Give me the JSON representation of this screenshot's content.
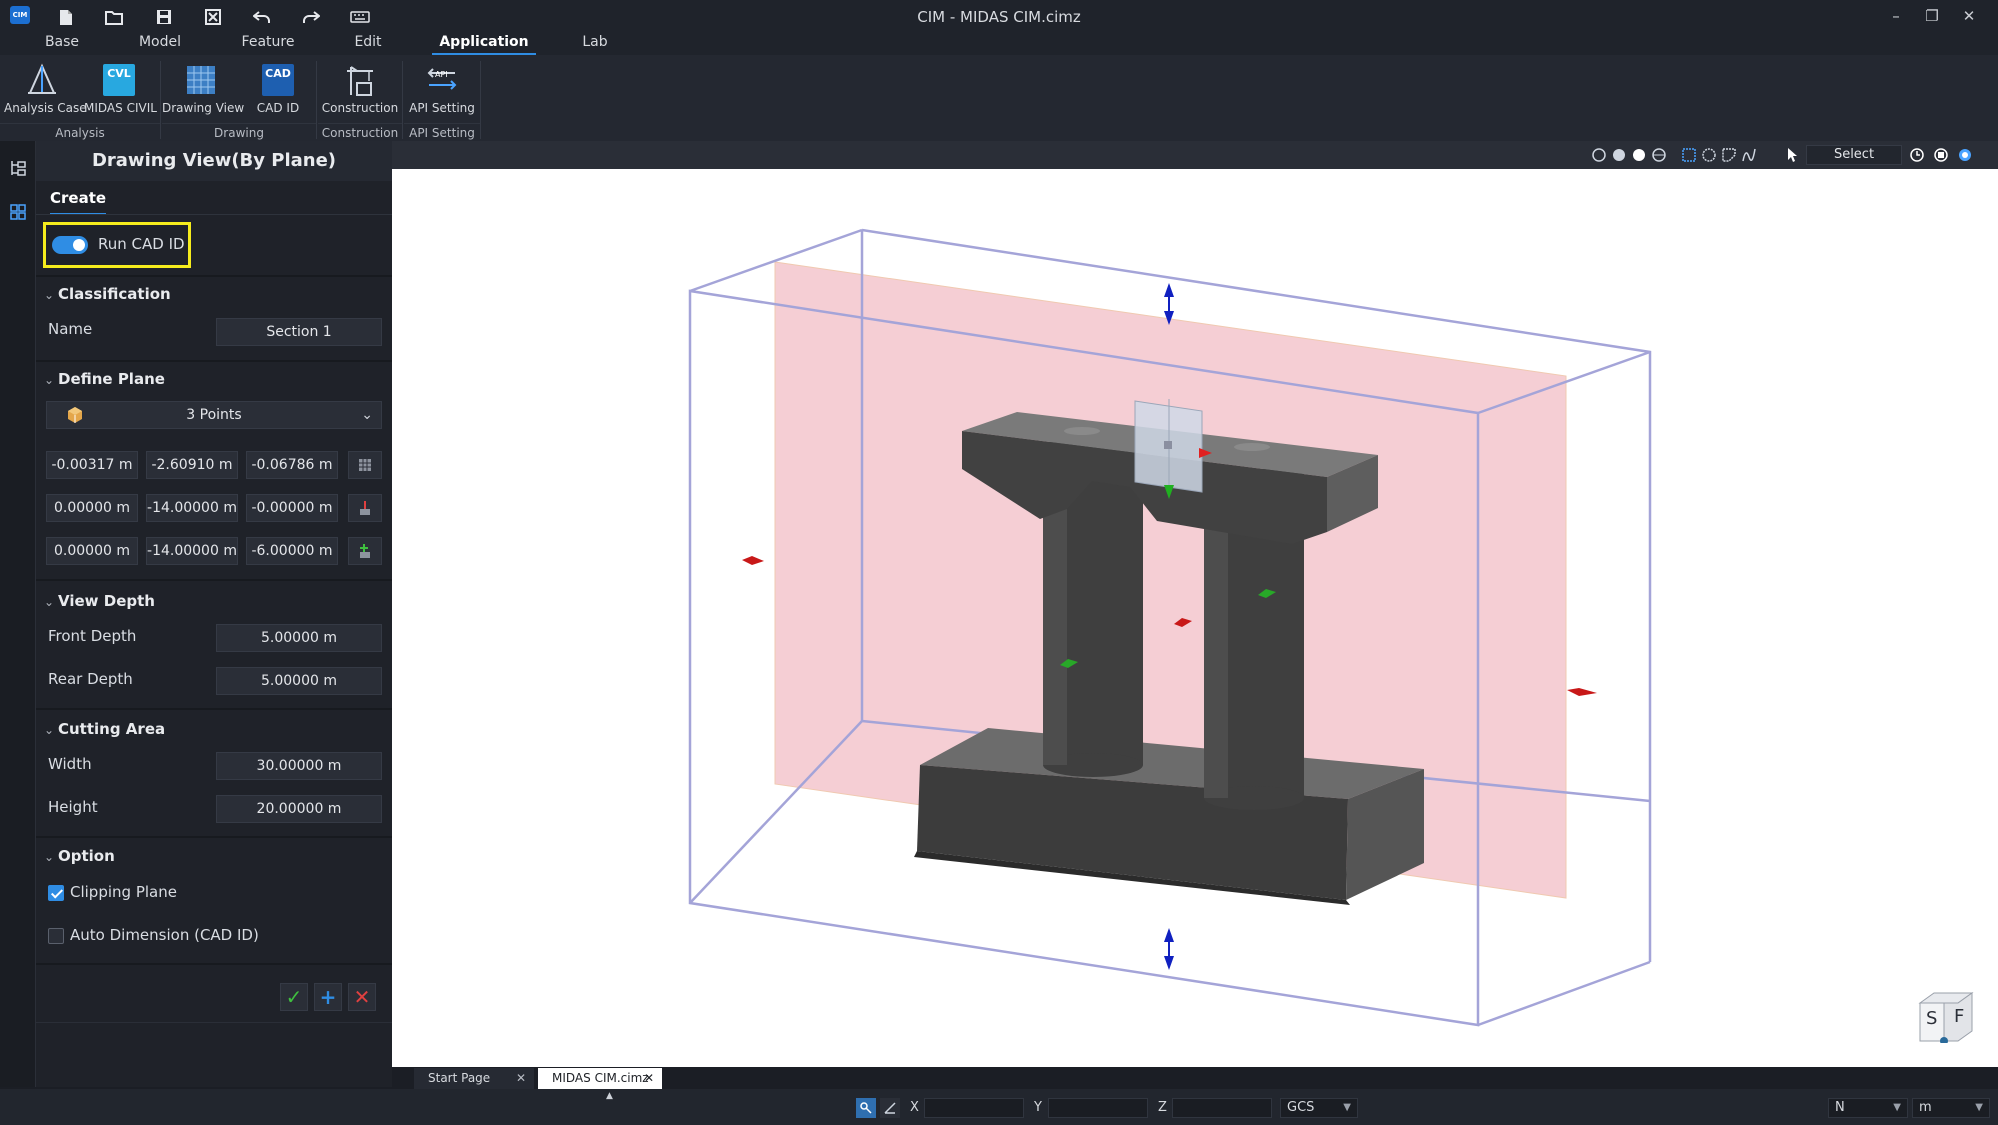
{
  "window": {
    "title": "CIM - MIDAS CIM.cimz",
    "logo_text": "CIM"
  },
  "quick_access": [
    "new-file-icon",
    "open-folder-icon",
    "save-icon",
    "close-file-icon",
    "undo-icon",
    "redo-icon",
    "keyboard-icon"
  ],
  "menu": {
    "tabs": [
      {
        "label": "Base"
      },
      {
        "label": "Model"
      },
      {
        "label": "Feature"
      },
      {
        "label": "Edit"
      },
      {
        "label": "Application",
        "active": true
      },
      {
        "label": "Lab"
      }
    ]
  },
  "ribbon": {
    "buttons": [
      {
        "label": "Analysis Case",
        "icon": "analysis-case-icon"
      },
      {
        "label": "MIDAS CIVIL",
        "icon": "midas-civil-icon",
        "badge": "CVL"
      },
      {
        "label": "Drawing View",
        "icon": "drawing-view-icon"
      },
      {
        "label": "CAD ID",
        "icon": "cad-id-icon",
        "badge": "CAD"
      },
      {
        "label": "Construction",
        "icon": "construction-icon"
      },
      {
        "label": "API Setting",
        "icon": "api-setting-icon",
        "badge": "API"
      }
    ],
    "groups": [
      "Analysis",
      "Drawing",
      "Construction",
      "API Setting"
    ]
  },
  "panel": {
    "title": "Drawing View(By Plane)",
    "tab": "Create",
    "run_cad_id": {
      "label": "Run CAD ID",
      "enabled": true
    },
    "classification": {
      "header": "Classification",
      "name_label": "Name",
      "name_value": "Section 1"
    },
    "define_plane": {
      "header": "Define Plane",
      "method": "3 Points",
      "points": [
        [
          "-0.00317 m",
          "-2.60910 m",
          "-0.06786 m"
        ],
        [
          "0.00000 m",
          "-14.00000 m",
          "-0.00000 m"
        ],
        [
          "0.00000 m",
          "-14.00000 m",
          "-6.00000 m"
        ]
      ]
    },
    "view_depth": {
      "header": "View Depth",
      "front_label": "Front Depth",
      "front_value": "5.00000 m",
      "rear_label": "Rear Depth",
      "rear_value": "5.00000 m"
    },
    "cutting_area": {
      "header": "Cutting Area",
      "width_label": "Width",
      "width_value": "30.00000 m",
      "height_label": "Height",
      "height_value": "20.00000 m"
    },
    "option": {
      "header": "Option",
      "clipping_plane": {
        "label": "Clipping Plane",
        "checked": true
      },
      "auto_dimension": {
        "label": "Auto Dimension (CAD ID)",
        "checked": false
      }
    }
  },
  "viewport_toolbar": {
    "select_label": "Select"
  },
  "view_cube": {
    "left_face": "S",
    "right_face": "F"
  },
  "doc_tabs": [
    {
      "label": "Start Page",
      "active": false
    },
    {
      "label": "MIDAS CIM.cimz",
      "active": true
    }
  ],
  "status": {
    "x_label": "X",
    "y_label": "Y",
    "z_label": "Z",
    "coord_system": "GCS",
    "force_unit": "N",
    "length_unit": "m"
  },
  "colors": {
    "accent": "#2f8de4",
    "highlight": "#f5ec1d",
    "plane": "#f3c6cc",
    "box": "#8f8fcf"
  }
}
